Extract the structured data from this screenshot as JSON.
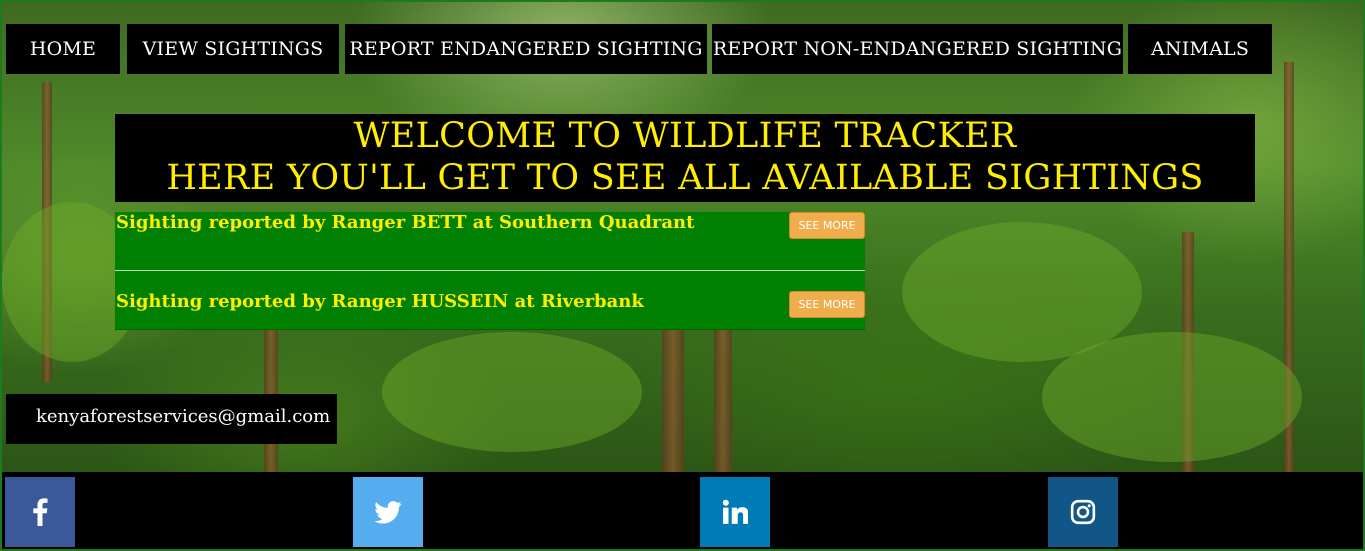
{
  "nav": {
    "items": [
      {
        "label": "HOME"
      },
      {
        "label": "VIEW SIGHTINGS"
      },
      {
        "label": "REPORT ENDANGERED SIGHTING"
      },
      {
        "label": "REPORT NON-ENDANGERED SIGHTING"
      },
      {
        "label": "ANIMALS"
      }
    ]
  },
  "banner": {
    "line1": "WELCOME TO WILDLIFE TRACKER",
    "line2": "HERE YOU'LL GET TO SEE ALL AVAILABLE SIGHTINGS"
  },
  "sightings": [
    {
      "text": "Sighting reported by Ranger BETT at Southern Quadrant",
      "button": "SEE MORE"
    },
    {
      "text": "Sighting reported by Ranger HUSSEIN at Riverbank",
      "button": "SEE MORE"
    }
  ],
  "contact": {
    "email": "kenyaforestservices@gmail.com"
  },
  "social": {
    "items": [
      {
        "icon": "facebook-icon",
        "color": "#3b5998"
      },
      {
        "icon": "twitter-icon",
        "color": "#55acee"
      },
      {
        "icon": "linkedin-icon",
        "color": "#007bb5"
      },
      {
        "icon": "instagram-icon",
        "color": "#125688"
      }
    ]
  },
  "colors": {
    "banner_text": "#ffee00",
    "sighting_bg": "#008000",
    "button_bg": "#f0ad4e"
  }
}
